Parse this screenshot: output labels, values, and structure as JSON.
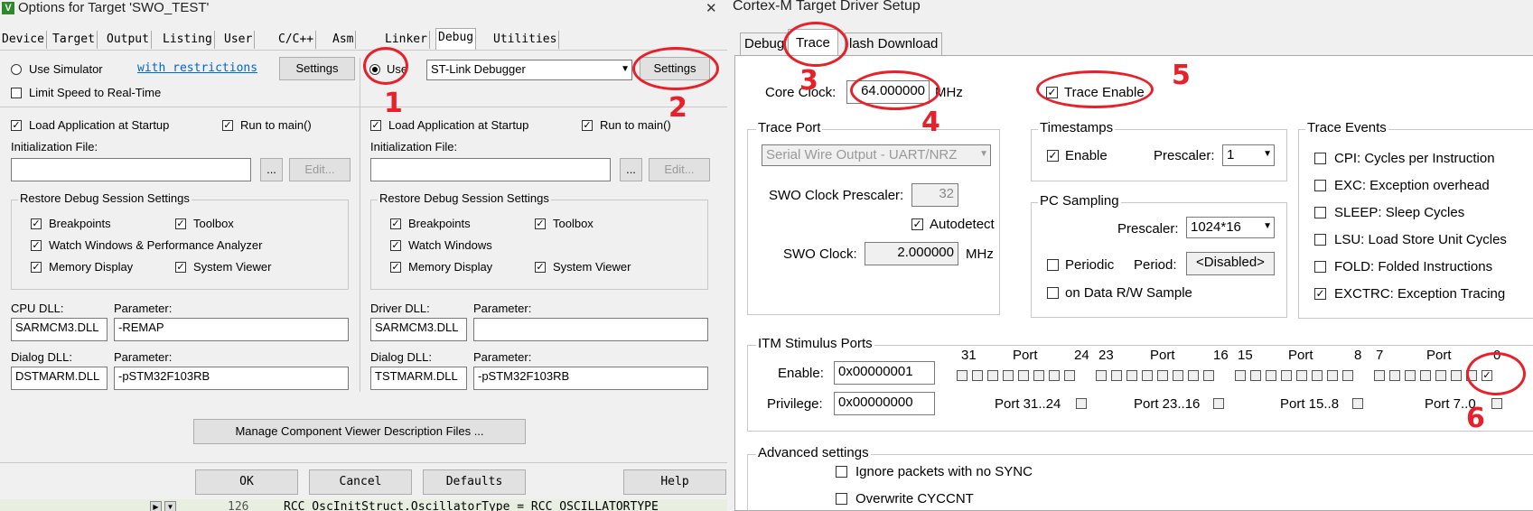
{
  "left": {
    "window_title": "Options for Target 'SWO_TEST'",
    "close_glyph": "✕",
    "tabs": [
      "Device",
      "Target",
      "Output",
      "Listing",
      "User",
      "C/C++",
      "Asm",
      "Linker",
      "Debug",
      "Utilities"
    ],
    "active_tab": "Debug",
    "sim": {
      "use_simulator": "Use Simulator",
      "with_restrictions": "with restrictions",
      "settings": "Settings",
      "limit_speed": "Limit Speed to Real-Time",
      "load_app": "Load Application at Startup",
      "run_main": "Run to main()",
      "init_file": "Initialization File:",
      "browse": "...",
      "edit": "Edit...",
      "restore": "Restore Debug Session Settings",
      "breakpoints": "Breakpoints",
      "toolbox": "Toolbox",
      "watch": "Watch Windows & Performance Analyzer",
      "memory": "Memory Display",
      "sysviewer": "System Viewer",
      "cpu_dll_label": "CPU DLL:",
      "param_label": "Parameter:",
      "cpu_dll": "SARMCM3.DLL",
      "cpu_param": "-REMAP",
      "dialog_dll_label": "Dialog DLL:",
      "dialog_dll": "DSTMARM.DLL",
      "dialog_param": "-pSTM32F103RB"
    },
    "hw": {
      "use": "Use",
      "debugger": "ST-Link Debugger",
      "settings": "Settings",
      "load_app": "Load Application at Startup",
      "run_main": "Run to main()",
      "init_file": "Initialization File:",
      "browse": "...",
      "edit": "Edit...",
      "restore": "Restore Debug Session Settings",
      "breakpoints": "Breakpoints",
      "toolbox": "Toolbox",
      "watch": "Watch Windows",
      "memory": "Memory Display",
      "sysviewer": "System Viewer",
      "driver_dll_label": "Driver DLL:",
      "param_label": "Parameter:",
      "driver_dll": "SARMCM3.DLL",
      "driver_param": "",
      "dialog_dll_label": "Dialog DLL:",
      "dialog_dll": "TSTMARM.DLL",
      "dialog_param": "-pSTM32F103RB"
    },
    "manage_btn": "Manage Component Viewer Description Files ...",
    "ok": "OK",
    "cancel": "Cancel",
    "defaults": "Defaults",
    "help": "Help",
    "code_line_no": "126",
    "code_text": "RCC_OscInitStruct.OscillatorType = RCC_OSCILLATORTYPE_"
  },
  "right": {
    "window_title": "Cortex-M Target Driver Setup",
    "tabs": [
      "Debug",
      "Trace",
      "Flash Download"
    ],
    "tab_flash_visible": "lash Download",
    "active_tab": "Trace",
    "core_clock_label": "Core Clock:",
    "core_clock": "64.000000",
    "mhz": "MHz",
    "trace_enable": "Trace Enable",
    "trace_port": {
      "caption": "Trace Port",
      "port": "Serial Wire Output - UART/NRZ",
      "swo_prescaler_label": "SWO Clock Prescaler:",
      "swo_prescaler": "32",
      "autodetect": "Autodetect",
      "swo_clock_label": "SWO Clock:",
      "swo_clock": "2.000000",
      "mhz": "MHz"
    },
    "timestamps": {
      "caption": "Timestamps",
      "enable": "Enable",
      "prescaler_label": "Prescaler:",
      "prescaler": "1"
    },
    "pc_sampling": {
      "caption": "PC Sampling",
      "prescaler_label": "Prescaler:",
      "prescaler": "1024*16",
      "periodic": "Periodic",
      "period_label": "Period:",
      "period": "<Disabled>",
      "on_data": "on Data R/W Sample"
    },
    "trace_events": {
      "caption": "Trace Events",
      "items": [
        {
          "label": "CPI: Cycles per Instruction",
          "checked": false
        },
        {
          "label": "EXC: Exception overhead",
          "checked": false
        },
        {
          "label": "SLEEP: Sleep Cycles",
          "checked": false
        },
        {
          "label": "LSU: Load Store Unit Cycles",
          "checked": false
        },
        {
          "label": "FOLD: Folded Instructions",
          "checked": false
        },
        {
          "label": "EXCTRC: Exception Tracing",
          "checked": true
        }
      ]
    },
    "itm": {
      "caption": "ITM Stimulus Ports",
      "bit_headers": [
        "31",
        "Port",
        "24",
        "23",
        "Port",
        "16",
        "15",
        "Port",
        "8",
        "7",
        "Port",
        "0"
      ],
      "enable_label": "Enable:",
      "enable": "0x00000001",
      "privilege_label": "Privilege:",
      "privilege": "0x00000000",
      "port_groups": [
        "Port 31..24",
        "Port 23..16",
        "Port 15..8",
        "Port 7..0"
      ]
    },
    "advanced": {
      "caption": "Advanced settings",
      "ignore_sync": "Ignore packets with no SYNC",
      "overwrite": "Overwrite CYCCNT"
    }
  },
  "annotations": [
    "1",
    "2",
    "3",
    "4",
    "5",
    "6"
  ],
  "colors": {
    "annotation": "#e8202a",
    "link": "#0066cc"
  }
}
